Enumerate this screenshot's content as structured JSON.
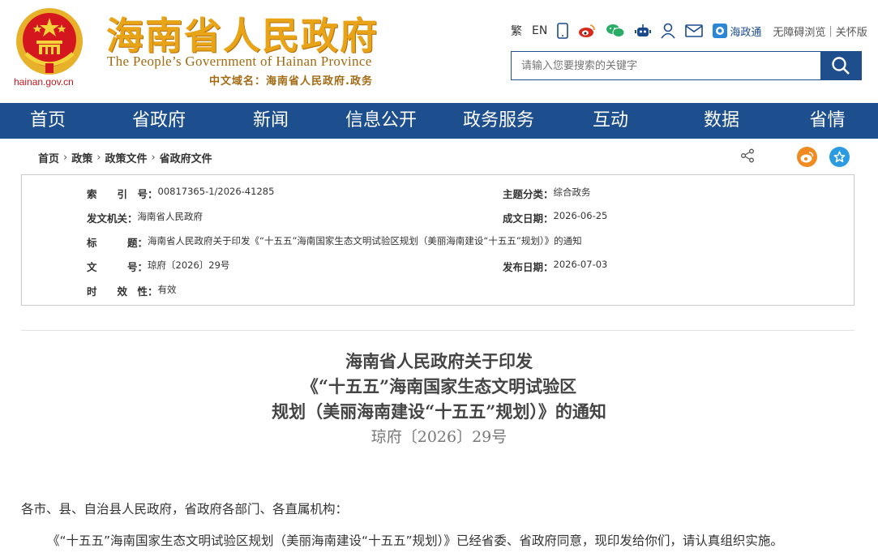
{
  "header": {
    "domain_small": "hainan.gov.cn",
    "title_cn": "海南省人民政府",
    "title_en": "The People’s Government  of Hainan Province",
    "domain_cn": "中文域名：海南省人民政府.政务",
    "links": {
      "traditional": "繁",
      "english": "EN",
      "zhengwutong": "海政通",
      "accessible": "无障碍浏览",
      "elderly": "关怀版",
      "separator": "|"
    },
    "search_placeholder": "请输入您要搜索的关键字"
  },
  "nav": {
    "items": [
      "首页",
      "省政府",
      "新闻",
      "信息公开",
      "政务服务",
      "互动",
      "数据",
      "省情"
    ]
  },
  "breadcrumb": {
    "items": [
      "首页",
      "政策",
      "政策文件",
      "省政府文件"
    ]
  },
  "info": {
    "index_label": "索　　引　号：",
    "index_value": "00817365-1/2026-41285",
    "category_label": "主题分类：",
    "category_value": "综合政务",
    "issuer_label": "发文机关：",
    "issuer_value": "海南省人民政府",
    "created_label": "成文日期：",
    "created_value": "2026-06-25",
    "title_label": "标　　　题：",
    "title_value": "海南省人民政府关于印发《“十五五”海南国家生态文明试验区规划（美丽海南建设“十五五”规划）》的通知",
    "docno_label": "文　　　号：",
    "docno_value": "琼府〔2026〕29号",
    "published_label": "发布日期：",
    "published_value": "2026-07-03",
    "validity_label": "时　　效　性：",
    "validity_value": "有效"
  },
  "document": {
    "title_line1": "海南省人民政府关于印发",
    "title_line2": "《“十五五”海南国家生态文明试验区",
    "title_line3": "规划（美丽海南建设“十五五”规划）》的通知",
    "doc_number": "琼府〔2026〕29号",
    "salutation": "各市、县、自治县人民政府，省政府各部门、各直属机构：",
    "body_line1": "《“十五五”海南国家生态文明试验区规划（美丽海南建设“十五五”规划）》已经省委、省政府同意，现印发给你们，请认真组织实施。"
  },
  "colors": {
    "nav_bg": "#1d4f8e",
    "title_gold": "#e8a317",
    "emblem_red": "#c7161e"
  }
}
